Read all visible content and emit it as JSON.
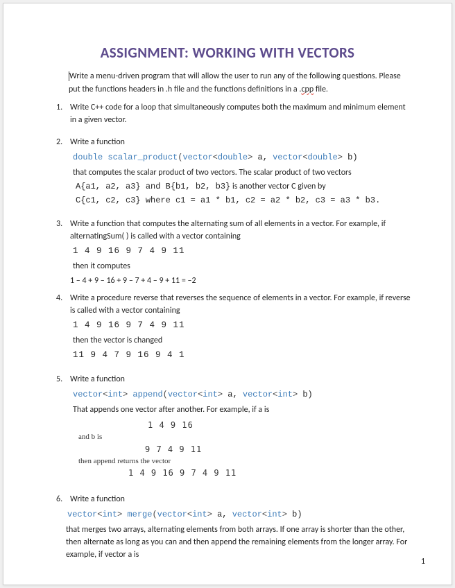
{
  "title": "ASSIGNMENT: WORKING WITH VECTORS",
  "intro_part1": "Write a menu-driven program that will allow the user to run any of the following questions. Please put the functions headers in .h file and the functions definitions in a .",
  "intro_cpp": "cpp",
  "intro_part2": " file.",
  "page_number": "1",
  "q1": {
    "num": "1.",
    "text": "Write C++ code for a loop that simultaneously computes both the maximum and minimum element in a given vector."
  },
  "q2": {
    "num": "2.",
    "lead": "Write a function",
    "sig": {
      "type": "double",
      "fn": "scalar_product",
      "p1_tmpl": "vector",
      "p1_in1": "<",
      "p1_inner": "double",
      "p1_in2": ">",
      "p1_name": " a, ",
      "p2_tmpl": "vector",
      "p2_in1": "<",
      "p2_inner": "double",
      "p2_in2": ">",
      "p2_name": " b)"
    },
    "line2": "that computes the scalar product of two vectors. The scalar product of two vectors",
    "line3a": "A{a1, a2, a3} and B{b1, b2, b3}",
    "line3b": " is another vector C given by",
    "line4": "C{c1, c2, c3} where c1 = a1 * b1, c2 = a2 * b2, c3 = a3 * b3."
  },
  "q3": {
    "num": "3.",
    "text": "Write a function that computes the alternating sum of all elements in a vector. For example, if alternatingSum( ) is called with a vector containing",
    "seq": "1 4 9 16 9 7 4 9 11",
    "then": "then it computes",
    "expr": "1 – 4 + 9 – 16 + 9 – 7 + 4 – 9 + 11 = –2"
  },
  "q4": {
    "num": "4.",
    "text": "Write a procedure reverse that reverses the sequence of elements in a vector. For example, if reverse is called with a vector containing",
    "seq1": "1 4 9 16 9 7 4 9 11",
    "then": "then the vector is changed",
    "seq2": "11 9 4 7 9 16 9 4 1"
  },
  "q5": {
    "num": "5.",
    "lead": "Write a function",
    "sig": {
      "ret_tmpl": "vector",
      "ret_in1": "<",
      "ret_inner": "int",
      "ret_in2": ">",
      "fn": " append",
      "open": "(",
      "p1_tmpl": "vector",
      "p1_in1": "<",
      "p1_inner": "int",
      "p1_in2": ">",
      "p1_name": " a, ",
      "p2_tmpl": "vector",
      "p2_in1": "<",
      "p2_inner": "int",
      "p2_in2": ">",
      "p2_name": " b)"
    },
    "line2": "That appends one vector after another. For example, if a is",
    "block": {
      "l1_nums": "1 4 9 16",
      "l2_label": "and b is",
      "l2_nums": "9 7 4 9 11",
      "l3_label": "then append returns the vector",
      "l3_nums": "1 4 9 16 9 7 4 9 11"
    }
  },
  "q6": {
    "num": "6.",
    "lead": "Write a function",
    "sig": {
      "ret_tmpl": "vector",
      "ret_in1": "<",
      "ret_inner": "int",
      "ret_in2": ">",
      "fn": " merge",
      "open": "(",
      "p1_tmpl": "vector",
      "p1_in1": "<",
      "p1_inner": "int",
      "p1_in2": ">",
      "p1_name": " a, ",
      "p2_tmpl": "vector",
      "p2_in1": "<",
      "p2_inner": "int",
      "p2_in2": ">",
      "p2_name": " b)"
    },
    "text": "that merges two arrays, alternating elements from both arrays. If one array is shorter than the other, then alternate as long as you can and then append the remaining elements from the longer array. For example, if vector a is"
  }
}
